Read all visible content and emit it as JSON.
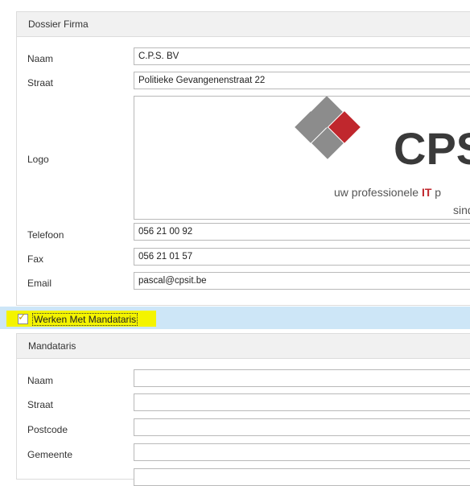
{
  "dossier": {
    "title": "Dossier Firma",
    "labels": {
      "naam": "Naam",
      "straat": "Straat",
      "logo": "Logo",
      "telefoon": "Telefoon",
      "fax": "Fax",
      "email": "Email"
    },
    "values": {
      "naam": "C.P.S. BV",
      "straat": "Politieke Gevangenenstraat 22",
      "telefoon": "056 21 00 92",
      "fax": "056 21 01 57",
      "email": "pascal@cpsit.be"
    },
    "logo": {
      "brand": "CPS",
      "tagline_prefix": "uw professionele ",
      "tagline_highlight": "IT",
      "tagline_suffix": " p",
      "tagline_line2": "sinds",
      "colors": {
        "diamond_gray": "#8c8c8c",
        "diamond_red": "#c0272d",
        "brand_text": "#3a3a3a",
        "highlight": "#c0272d"
      }
    }
  },
  "checkbox": {
    "label": "Werken Met Mandataris",
    "checked": true
  },
  "mandataris": {
    "title": "Mandataris",
    "labels": {
      "naam": "Naam",
      "straat": "Straat",
      "postcode": "Postcode",
      "gemeente": "Gemeente"
    },
    "values": {
      "naam": "",
      "straat": "",
      "postcode": "",
      "gemeente": ""
    }
  }
}
